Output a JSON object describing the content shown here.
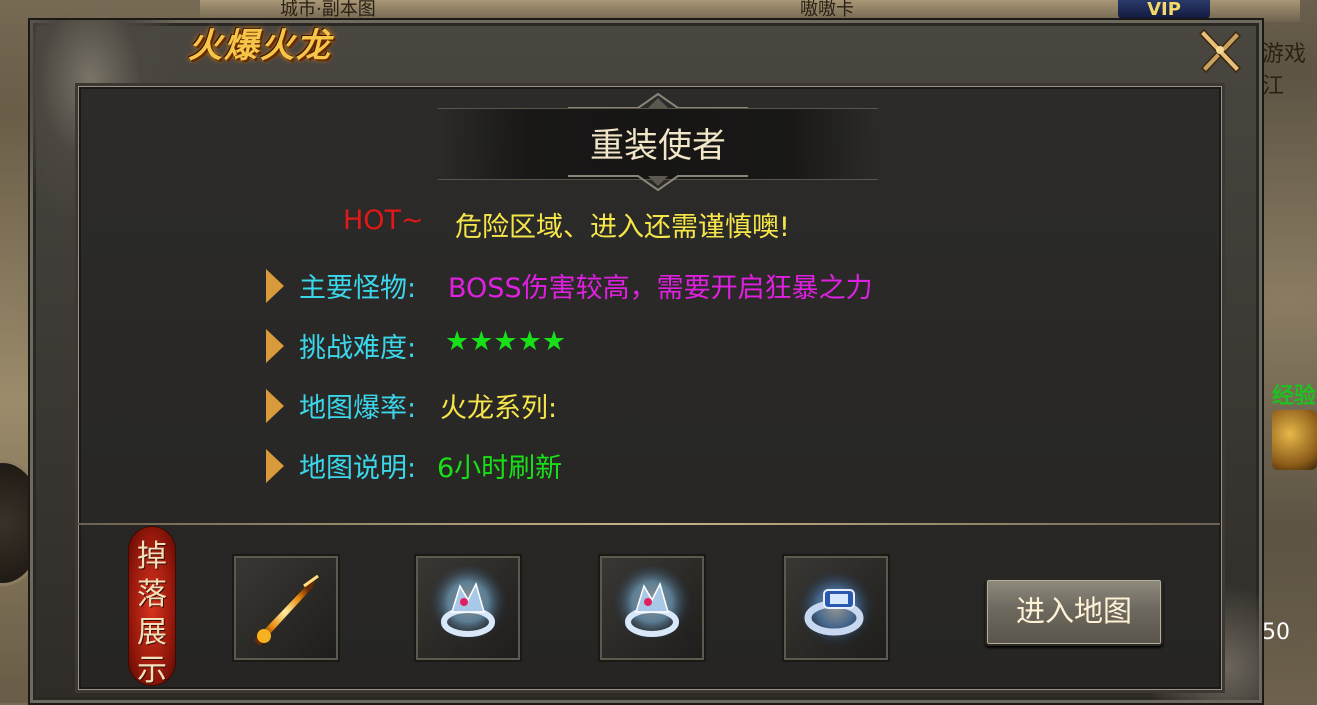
{
  "background": {
    "top_text_1": "城市·副本图",
    "top_text_2": "嗷嗷卡",
    "vip_label": "VIP",
    "side_text": "游戏江",
    "side_green_text": "经验",
    "coin_count": "50"
  },
  "panel": {
    "title": "火爆火龙",
    "map_name": "重装使者",
    "hot_label": "HOT~",
    "warning": "危险区域、进入还需谨慎噢!",
    "rows": [
      {
        "label": "主要怪物:",
        "value": "BOSS伤害较高，需要开启狂暴之力",
        "color": "#e020e0"
      },
      {
        "label": "挑战难度:",
        "value": "★★★★★",
        "color": "#18e018"
      },
      {
        "label": "地图爆率:",
        "value": "火龙系列:",
        "color": "#f6e64a"
      },
      {
        "label": "地图说明:",
        "value": "6小时刷新",
        "color": "#18e018"
      }
    ],
    "drop_badge": [
      "掉",
      "落",
      "展",
      "示"
    ],
    "drop_items": [
      {
        "icon": "flame-sword-icon"
      },
      {
        "icon": "ice-ring-icon"
      },
      {
        "icon": "ice-ring-icon"
      },
      {
        "icon": "blue-bracelet-icon"
      }
    ],
    "enter_button": "进入地图"
  }
}
